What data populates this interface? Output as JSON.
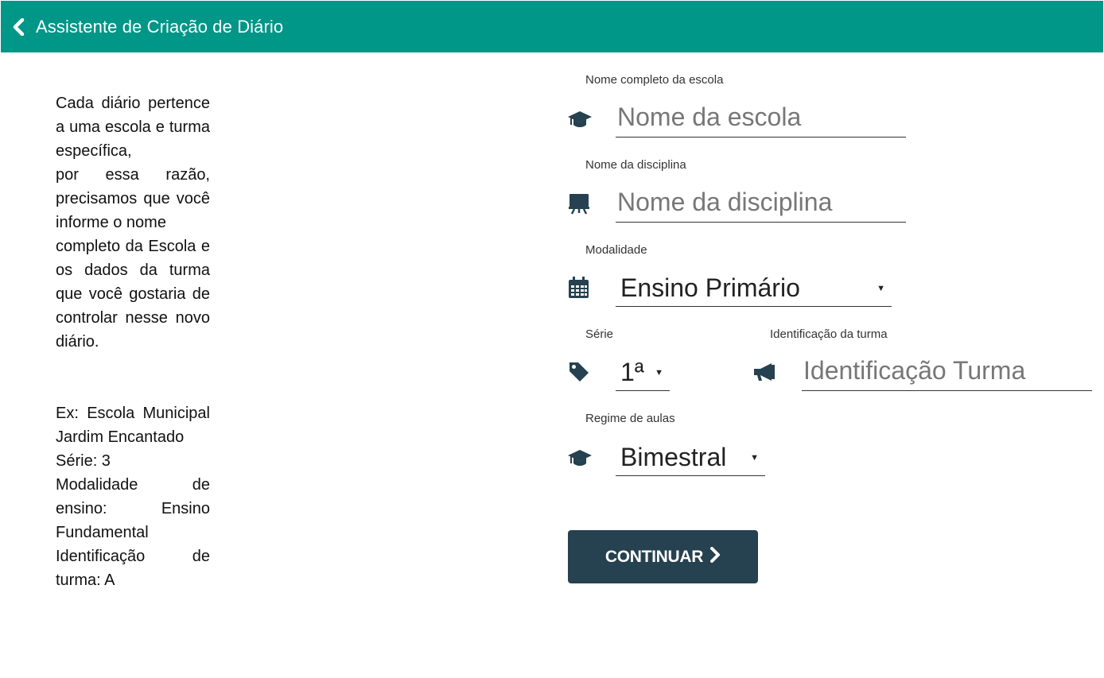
{
  "header": {
    "title": "Assistente de Criação de Diário"
  },
  "help": {
    "paragraph1": [
      "Cada diário pertence a uma escola e turma específica,",
      "por essa razão, precisamos que você informe o nome",
      "completo da Escola e os dados da turma que você gostaria de controlar nesse novo diário."
    ],
    "example": [
      "Ex: Escola Municipal Jardim Encantado",
      "Série: 3",
      "Modalidade de ensino: Ensino Fundamental",
      "Identificação de turma: A"
    ]
  },
  "form": {
    "school": {
      "label": "Nome completo da escola",
      "placeholder": "Nome da escola",
      "icon": "graduation-cap-icon"
    },
    "subject": {
      "label": "Nome da disciplina",
      "placeholder": "Nome da disciplina",
      "icon": "easel-icon"
    },
    "modality": {
      "label": "Modalidade",
      "value": "Ensino Primário",
      "icon": "calendar-icon"
    },
    "grade": {
      "label": "Série",
      "value": "1ª",
      "icon": "tag-icon"
    },
    "class_id": {
      "label": "Identificação da turma",
      "placeholder": "Identificação Turma",
      "icon": "megaphone-icon"
    },
    "regime": {
      "label": "Regime de aulas",
      "value": "Bimestral",
      "icon": "graduation-cap-icon"
    },
    "continue_label": "CONTINUAR"
  },
  "colors": {
    "header_bg": "#009688",
    "button_bg": "#26414f"
  }
}
